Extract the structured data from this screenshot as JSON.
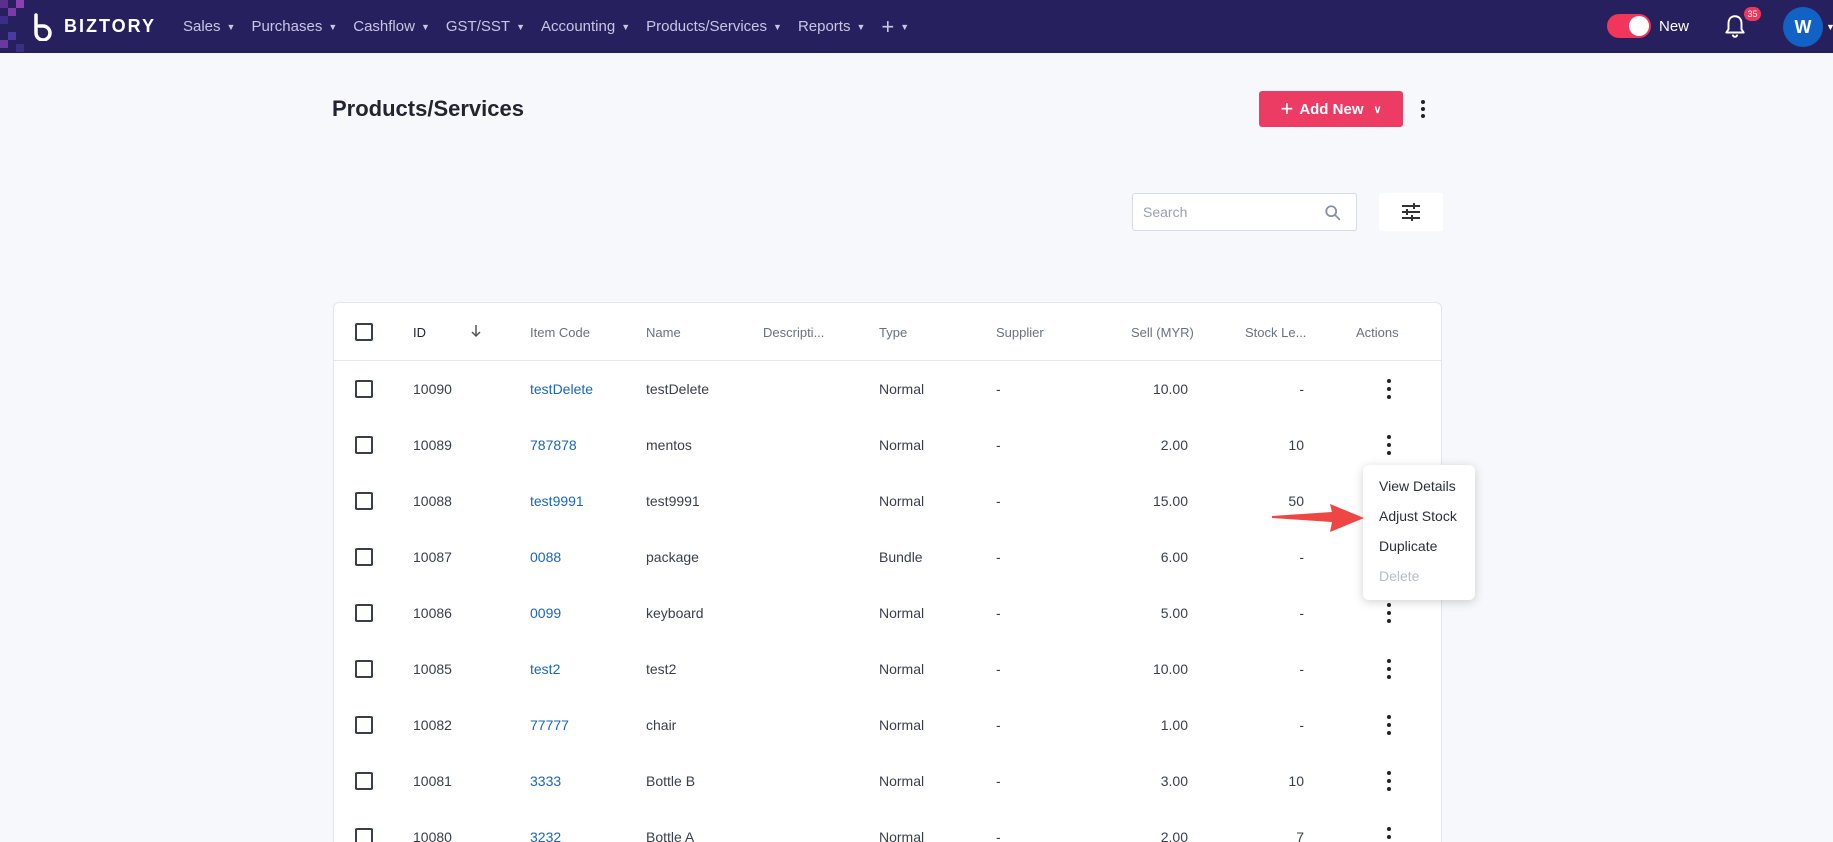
{
  "app": {
    "brand": "BIZTORY",
    "colors": {
      "nav_bg": "#26205e",
      "accent": "#ec3c63",
      "link": "#1a66b8",
      "avatar": "#1261c4"
    }
  },
  "nav": {
    "items": [
      {
        "label": "Sales"
      },
      {
        "label": "Purchases"
      },
      {
        "label": "Cashflow"
      },
      {
        "label": "GST/SST"
      },
      {
        "label": "Accounting"
      },
      {
        "label": "Products/Services"
      },
      {
        "label": "Reports"
      }
    ],
    "plus_icon": "plus-icon",
    "toggle_label": "New",
    "notification_count": "35",
    "avatar_initial": "W"
  },
  "page": {
    "title": "Products/Services",
    "add_new_label": "Add New",
    "search_placeholder": "Search"
  },
  "table": {
    "columns": {
      "id": "ID",
      "item_code": "Item Code",
      "name": "Name",
      "description": "Descripti...",
      "type": "Type",
      "supplier": "Supplier",
      "sell": "Sell (MYR)",
      "stock": "Stock Le...",
      "actions": "Actions"
    },
    "rows": [
      {
        "id": "10090",
        "code": "testDelete",
        "name": "testDelete",
        "desc": "",
        "type": "Normal",
        "supplier": "-",
        "sell": "10.00",
        "stock": "-"
      },
      {
        "id": "10089",
        "code": "787878",
        "name": "mentos",
        "desc": "",
        "type": "Normal",
        "supplier": "-",
        "sell": "2.00",
        "stock": "10"
      },
      {
        "id": "10088",
        "code": "test9991",
        "name": "test9991",
        "desc": "",
        "type": "Normal",
        "supplier": "-",
        "sell": "15.00",
        "stock": "50"
      },
      {
        "id": "10087",
        "code": "0088",
        "name": "package",
        "desc": "",
        "type": "Bundle",
        "supplier": "-",
        "sell": "6.00",
        "stock": "-"
      },
      {
        "id": "10086",
        "code": "0099",
        "name": "keyboard",
        "desc": "",
        "type": "Normal",
        "supplier": "-",
        "sell": "5.00",
        "stock": "-"
      },
      {
        "id": "10085",
        "code": "test2",
        "name": "test2",
        "desc": "",
        "type": "Normal",
        "supplier": "-",
        "sell": "10.00",
        "stock": "-"
      },
      {
        "id": "10082",
        "code": "77777",
        "name": "chair",
        "desc": "",
        "type": "Normal",
        "supplier": "-",
        "sell": "1.00",
        "stock": "-"
      },
      {
        "id": "10081",
        "code": "3333",
        "name": "Bottle B",
        "desc": "",
        "type": "Normal",
        "supplier": "-",
        "sell": "3.00",
        "stock": "10"
      },
      {
        "id": "10080",
        "code": "3232",
        "name": "Bottle A",
        "desc": "",
        "type": "Normal",
        "supplier": "-",
        "sell": "2.00",
        "stock": "7"
      }
    ]
  },
  "row_menu": {
    "items": [
      {
        "label": "View Details",
        "enabled": true
      },
      {
        "label": "Adjust Stock",
        "enabled": true
      },
      {
        "label": "Duplicate",
        "enabled": true
      },
      {
        "label": "Delete",
        "enabled": false
      }
    ]
  }
}
